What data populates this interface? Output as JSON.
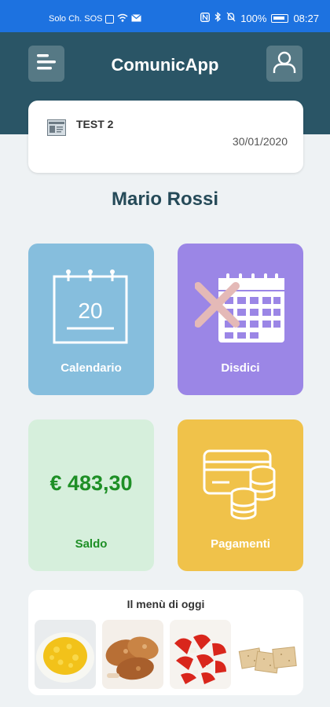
{
  "status_bar": {
    "carrier": "Solo Ch. SOS",
    "battery": "100%",
    "time": "08:27"
  },
  "header": {
    "title": "ComunicApp"
  },
  "notice": {
    "title": "TEST 2",
    "date": "30/01/2020"
  },
  "user": {
    "name": "Mario Rossi"
  },
  "tiles": {
    "calendar": {
      "label": "Calendario",
      "day": "20"
    },
    "cancel": {
      "label": "Disdici"
    },
    "balance": {
      "label": "Saldo",
      "amount": "€ 483,30"
    },
    "payments": {
      "label": "Pagamenti"
    }
  },
  "menu": {
    "title": "Il menù di oggi",
    "items": [
      "rice-dish",
      "roast-chicken",
      "tomato-salad",
      "crackers"
    ]
  },
  "colors": {
    "status_bar": "#1d72e0",
    "header": "#2a5566",
    "calendar_tile": "#86bedd",
    "cancel_tile": "#9b86e6",
    "balance_tile": "#d6efdc",
    "payments_tile": "#f0c24a",
    "balance_text": "#1e8f26"
  }
}
